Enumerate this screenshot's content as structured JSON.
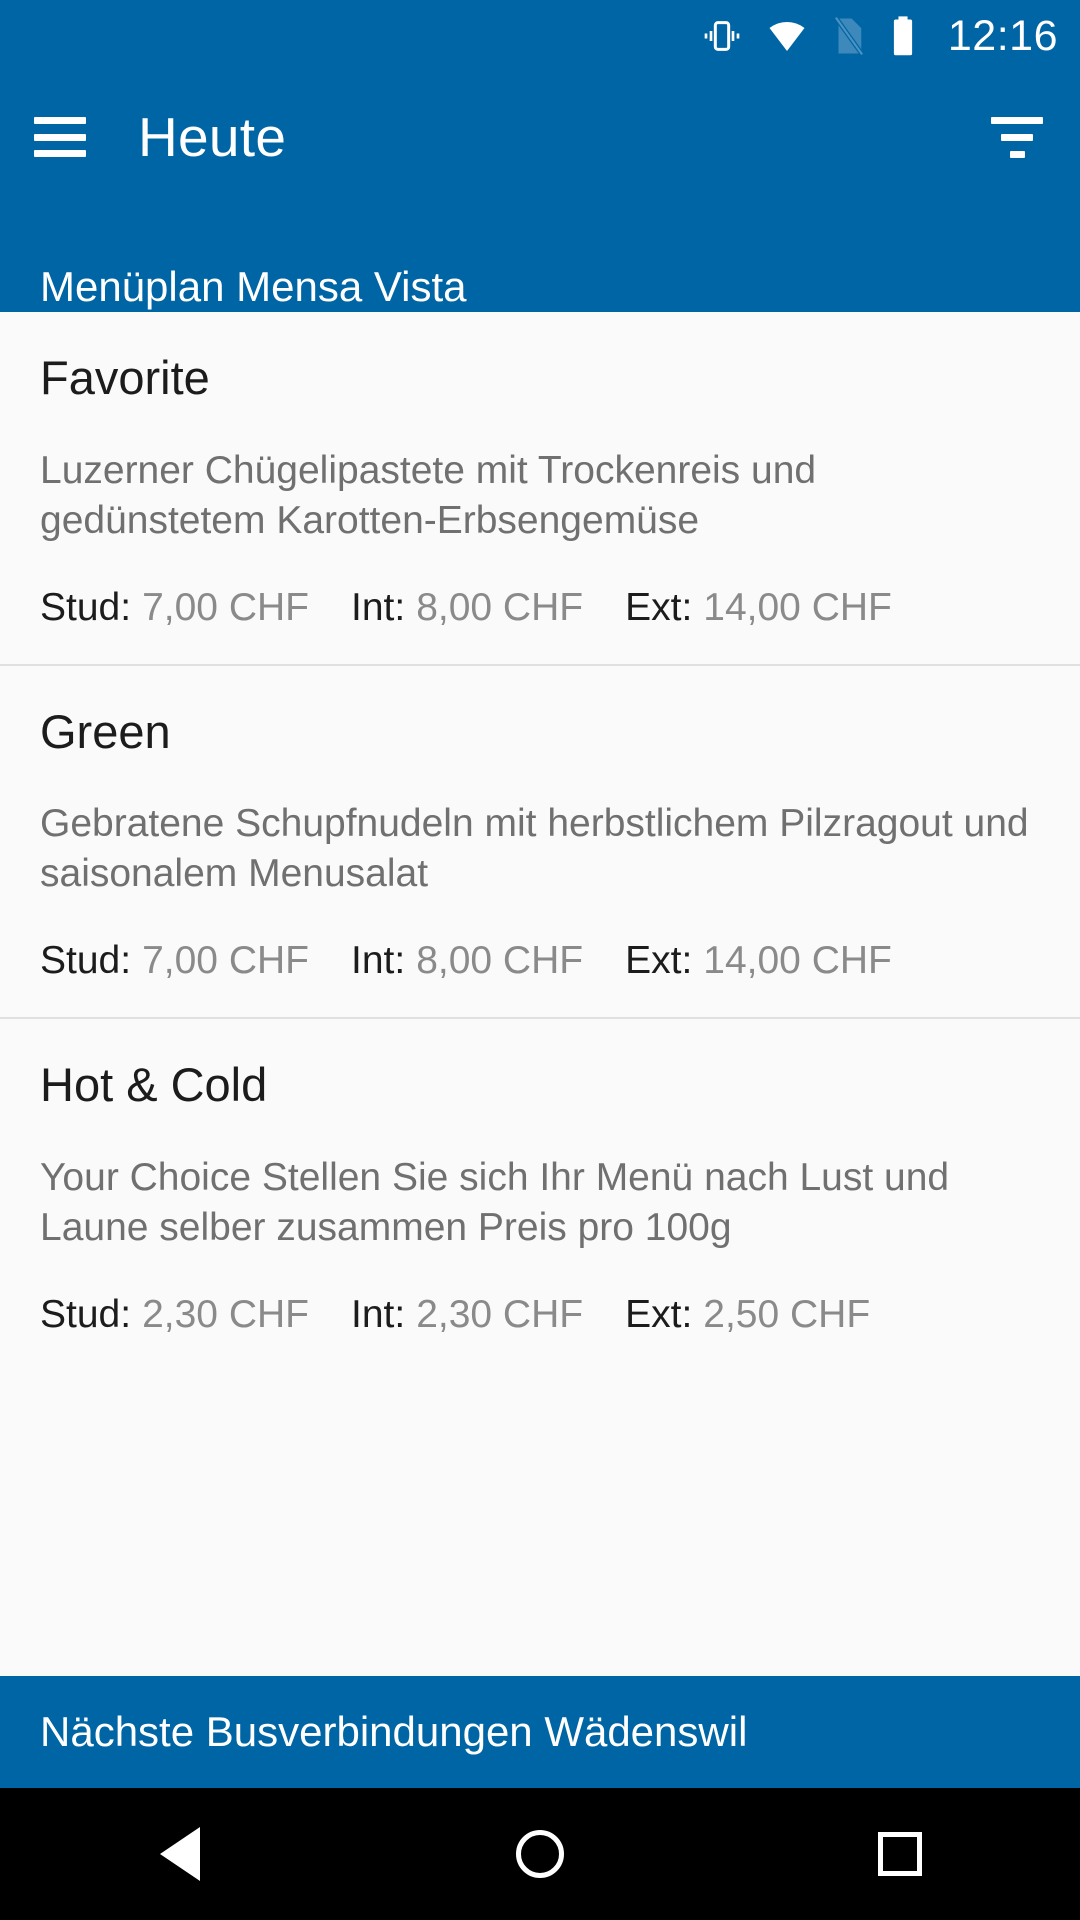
{
  "status_bar": {
    "time": "12:16",
    "icons": [
      "vibrate-icon",
      "wifi-icon",
      "no-sim-icon",
      "battery-icon"
    ]
  },
  "app_bar": {
    "menu_icon": "hamburger-menu-icon",
    "title": "Heute",
    "filter_icon": "filter-icon",
    "subtitle": "Menüplan Mensa Vista"
  },
  "colors": {
    "primary": "#0065a4",
    "background": "#fafafa",
    "text_primary": "#1c1c1c",
    "text_secondary": "#707070",
    "price_value": "#8a8a8a",
    "divider": "#e0e0e0"
  },
  "menus": [
    {
      "name": "Favorite",
      "description": "Luzerner Chügelipastete mit Trockenreis und gedünstetem Karotten-Erbsengemüse",
      "prices": [
        {
          "label": "Stud:",
          "value": "7,00 CHF"
        },
        {
          "label": "Int:",
          "value": "8,00 CHF"
        },
        {
          "label": "Ext:",
          "value": "14,00 CHF"
        }
      ]
    },
    {
      "name": "Green",
      "description": "Gebratene Schupfnudeln mit herbstlichem Pilzragout und saisonalem Menusalat",
      "prices": [
        {
          "label": "Stud:",
          "value": "7,00 CHF"
        },
        {
          "label": "Int:",
          "value": "8,00 CHF"
        },
        {
          "label": "Ext:",
          "value": "14,00 CHF"
        }
      ]
    },
    {
      "name": "Hot & Cold",
      "description": "Your Choice Stellen Sie sich Ihr Menü nach Lust und Laune selber zusammen Preis pro 100g",
      "prices": [
        {
          "label": "Stud:",
          "value": "2,30 CHF"
        },
        {
          "label": "Int:",
          "value": "2,30 CHF"
        },
        {
          "label": "Ext:",
          "value": "2,50 CHF"
        }
      ]
    }
  ],
  "bus_banner": {
    "title": "Nächste Busverbindungen Wädenswil"
  },
  "nav_bar": {
    "back": "back-triangle-icon",
    "home": "home-circle-icon",
    "recents": "recents-square-icon"
  }
}
